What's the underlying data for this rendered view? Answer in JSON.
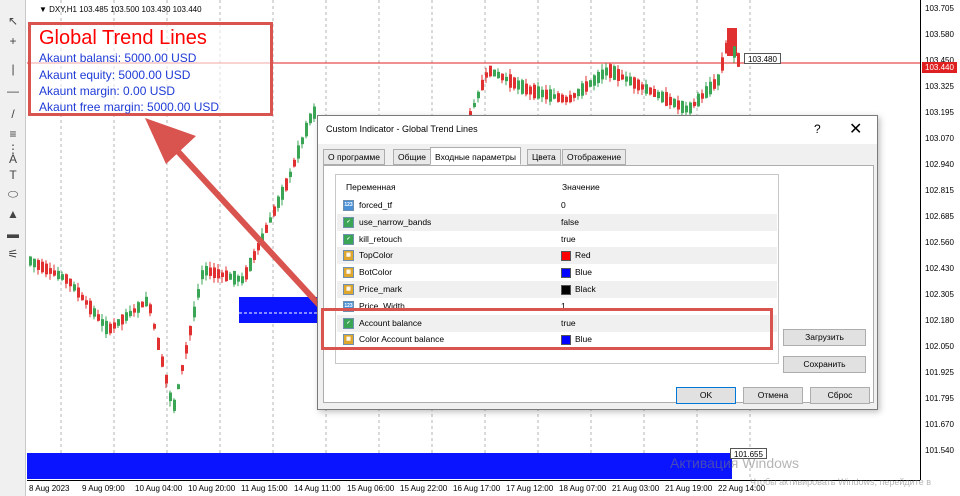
{
  "toolbar": {
    "items": [
      {
        "name": "cursor-icon",
        "glyph": "↖"
      },
      {
        "name": "crosshair-icon",
        "glyph": "+"
      },
      {
        "name": "vertical-line-icon",
        "glyph": "|"
      },
      {
        "name": "horizontal-line-icon",
        "glyph": "—"
      },
      {
        "name": "trendline-icon",
        "glyph": "/"
      },
      {
        "name": "channel-icon",
        "glyph": "≡"
      },
      {
        "name": "fibonacci-icon",
        "glyph": "⋮"
      },
      {
        "name": "text-icon",
        "glyph": "A"
      },
      {
        "name": "text-label-icon",
        "glyph": "T"
      },
      {
        "name": "ellipse-icon",
        "glyph": "⬭"
      },
      {
        "name": "triangle-icon",
        "glyph": "▲"
      },
      {
        "name": "rectangle-icon",
        "glyph": "▬"
      },
      {
        "name": "more-tools-icon",
        "glyph": "⚟"
      }
    ]
  },
  "chart": {
    "symbol_info": "▼ DXY,H1  103.485 103.500 103.430 103.440",
    "price_ticks": [
      "103.705",
      "103.580",
      "103.450",
      "103.325",
      "103.195",
      "103.070",
      "102.940",
      "102.815",
      "102.685",
      "102.560",
      "102.430",
      "102.305",
      "102.180",
      "102.050",
      "101.925",
      "101.795",
      "101.670",
      "101.540"
    ],
    "time_ticks": [
      "8 Aug 2023",
      "9 Aug 09:00",
      "10 Aug 04:00",
      "10 Aug 20:00",
      "11 Aug 15:00",
      "14 Aug 11:00",
      "15 Aug 06:00",
      "15 Aug 22:00",
      "16 Aug 17:00",
      "17 Aug 12:00",
      "18 Aug 07:00",
      "21 Aug 03:00",
      "21 Aug 19:00",
      "22 Aug 14:00"
    ],
    "current_price": "103.440",
    "line_label": "103.480",
    "low_label": "101.655",
    "colors": {
      "bull": "#3aa655",
      "bear": "#e03030",
      "zone": "#0a14ff",
      "price_line": "#e02020"
    }
  },
  "info_box": {
    "title": "Global Trend Lines",
    "lines": [
      "Akaunt balansi: 5000.00 USD",
      "Akaunt equity:   5000.00 USD",
      "Akaunt margin:  0.00 USD",
      "Akaunt free margin: 5000.00 USD"
    ]
  },
  "dialog": {
    "title": "Custom Indicator - Global Trend Lines",
    "help": "?",
    "close": "✕",
    "tabs": [
      "О программе",
      "Общие",
      "Входные параметры",
      "Цвета",
      "Отображение"
    ],
    "active_tab": 2,
    "headers": {
      "variable": "Переменная",
      "value": "Значение"
    },
    "params": [
      {
        "name": "forced_tf",
        "value": "0",
        "type": "num",
        "swatch": ""
      },
      {
        "name": "use_narrow_bands",
        "value": "false",
        "type": "bool",
        "swatch": ""
      },
      {
        "name": "kill_retouch",
        "value": "true",
        "type": "bool",
        "swatch": ""
      },
      {
        "name": "TopColor",
        "value": "Red",
        "type": "color",
        "swatch": "#ff0000"
      },
      {
        "name": "BotColor",
        "value": "Blue",
        "type": "color",
        "swatch": "#0000ff"
      },
      {
        "name": "Price_mark",
        "value": "Black",
        "type": "color",
        "swatch": "#000000"
      },
      {
        "name": "Price_Width",
        "value": "1",
        "type": "num",
        "swatch": ""
      },
      {
        "name": "Account balance",
        "value": "true",
        "type": "bool",
        "swatch": ""
      },
      {
        "name": "Color Account balance",
        "value": "Blue",
        "type": "color",
        "swatch": "#0000ff"
      }
    ],
    "buttons": {
      "load": "Загрузить",
      "save": "Сохранить",
      "ok": "OK",
      "cancel": "Отмена",
      "reset": "Сброс"
    }
  },
  "watermark": {
    "line1": "Активация Windows",
    "line2": "Чтобы активировать Windows, перейдите в"
  }
}
